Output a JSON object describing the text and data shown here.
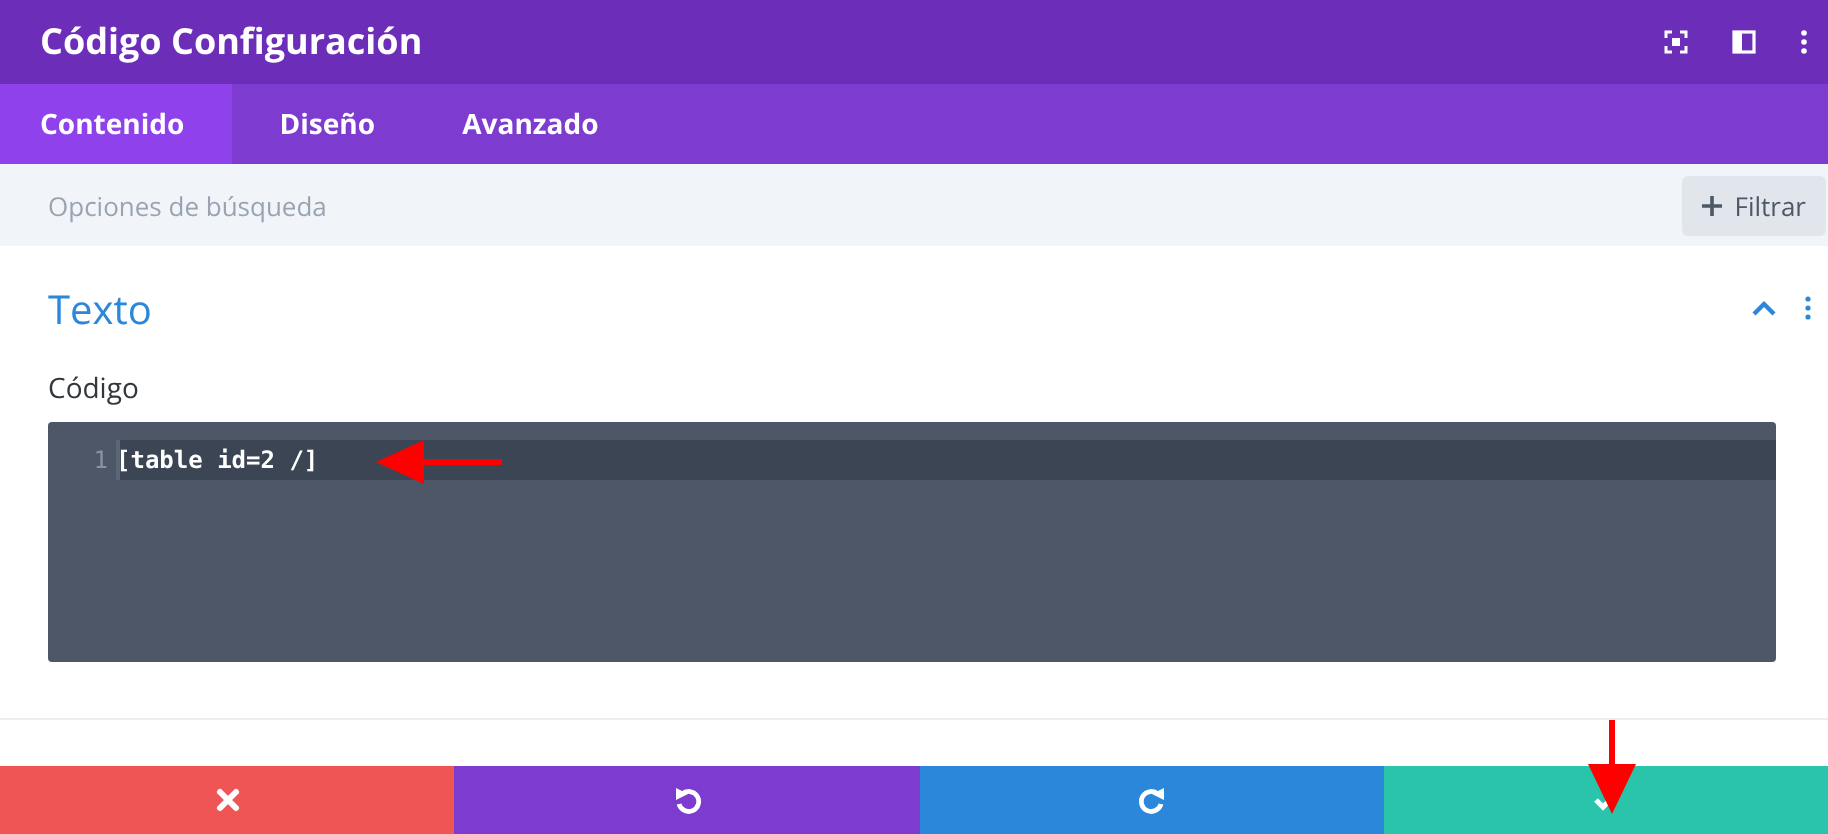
{
  "window": {
    "title": "Código Configuración"
  },
  "tabs": [
    {
      "label": "Contenido",
      "selected": true
    },
    {
      "label": "Diseño",
      "selected": false
    },
    {
      "label": "Avanzado",
      "selected": false
    }
  ],
  "search": {
    "placeholder": "Opciones de búsqueda"
  },
  "filter_button": {
    "label": "Filtrar"
  },
  "section": {
    "title": "Texto",
    "expanded": true,
    "field_label": "Código",
    "editor": {
      "lines": [
        {
          "number": "1",
          "code": "[table id=2 /]",
          "current": true
        }
      ]
    }
  },
  "footer_buttons": [
    {
      "kind": "discard"
    },
    {
      "kind": "undo"
    },
    {
      "kind": "redo"
    },
    {
      "kind": "save"
    }
  ]
}
